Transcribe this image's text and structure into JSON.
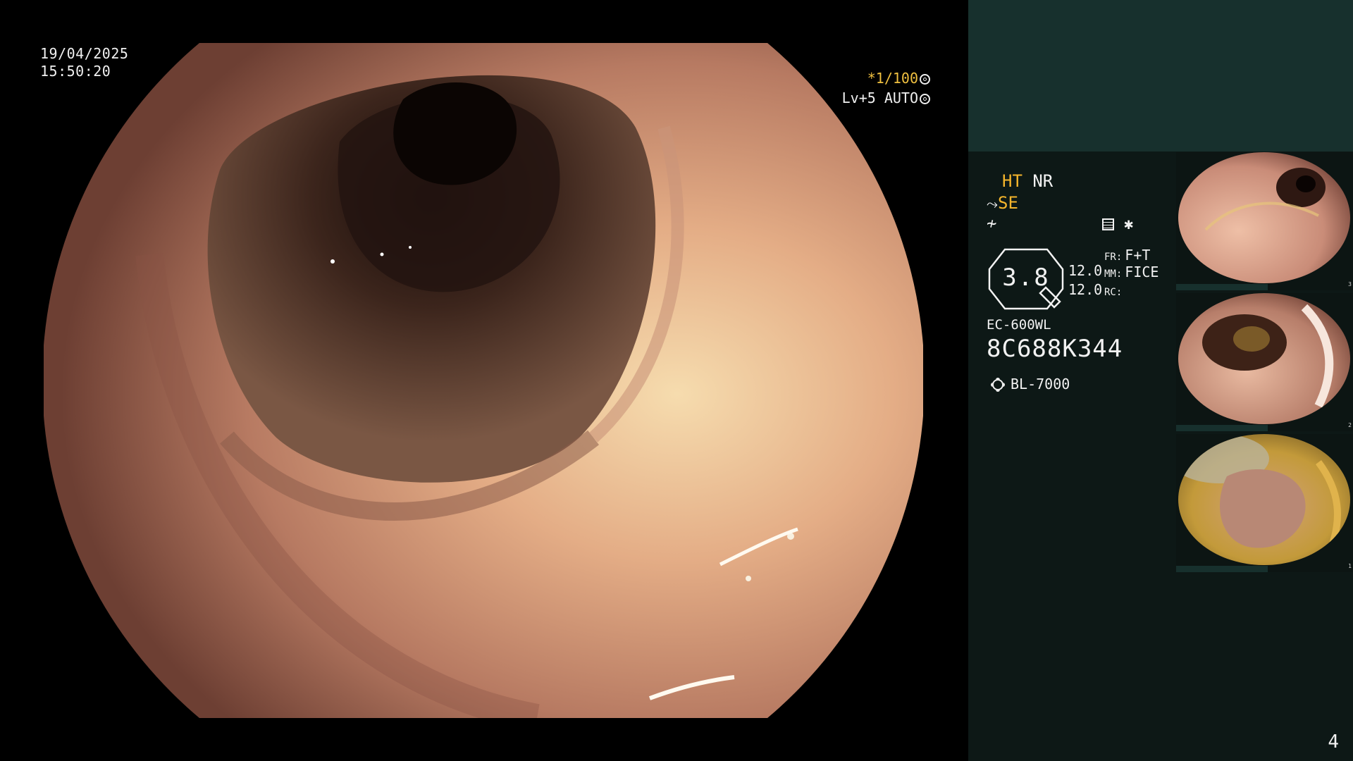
{
  "overlay": {
    "date": "19/04/2025",
    "time": "15:50:20",
    "shutter": "*1/100",
    "level": "Lv+5 AUTO"
  },
  "panel": {
    "ht": "HT",
    "nr": "NR",
    "se": "SE",
    "zoom_value": "3.8",
    "value_a": "12.0",
    "value_b": "12.0",
    "fr_label": "FR:",
    "fr_value": "F+T",
    "mm_label": "MM:",
    "mm_value": "FICE",
    "rc_label": "RC:",
    "scope_model": "EC-600WL",
    "serial": "8C688K344",
    "light_source": "BL-7000",
    "page_number": "4"
  },
  "thumbnails": [
    {
      "index": "3"
    },
    {
      "index": "2"
    },
    {
      "index": "1"
    }
  ],
  "colors": {
    "accent_yellow": "#f5b52c",
    "panel_bg": "#0d1816",
    "panel_top": "#17302d"
  }
}
